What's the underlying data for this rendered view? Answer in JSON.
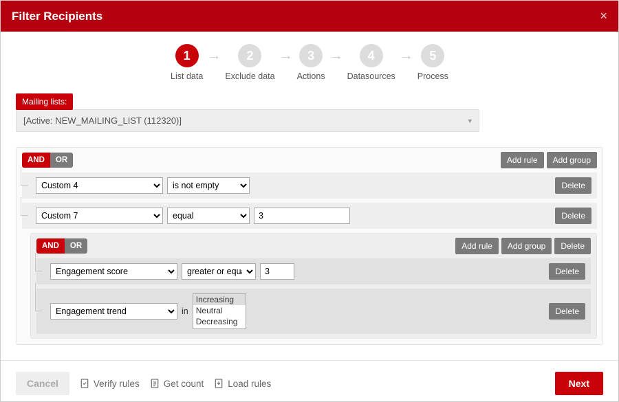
{
  "header": {
    "title": "Filter Recipients"
  },
  "stepper": [
    {
      "num": "1",
      "label": "List data",
      "active": true
    },
    {
      "num": "2",
      "label": "Exclude data",
      "active": false
    },
    {
      "num": "3",
      "label": "Actions",
      "active": false
    },
    {
      "num": "4",
      "label": "Datasources",
      "active": false
    },
    {
      "num": "5",
      "label": "Process",
      "active": false
    }
  ],
  "mailing": {
    "label": "Mailing lists:",
    "selected": "[Active: NEW_MAILING_LIST (112320)]"
  },
  "logic": {
    "and": "AND",
    "or": "OR"
  },
  "buttons": {
    "add_rule": "Add rule",
    "add_group": "Add group",
    "delete": "Delete"
  },
  "rules": {
    "r1": {
      "field": "Custom 4",
      "op": "is not empty"
    },
    "r2": {
      "field": "Custom 7",
      "op": "equal",
      "val": "3"
    },
    "inner": {
      "r3": {
        "field": "Engagement score",
        "op": "greater or equal",
        "val": "3"
      },
      "r4": {
        "field": "Engagement trend",
        "in_label": "in",
        "options": [
          "Increasing",
          "Neutral",
          "Decreasing"
        ],
        "selected": "Increasing"
      }
    }
  },
  "footer": {
    "cancel": "Cancel",
    "verify": "Verify rules",
    "get_count": "Get count",
    "load_rules": "Load rules",
    "next": "Next"
  }
}
